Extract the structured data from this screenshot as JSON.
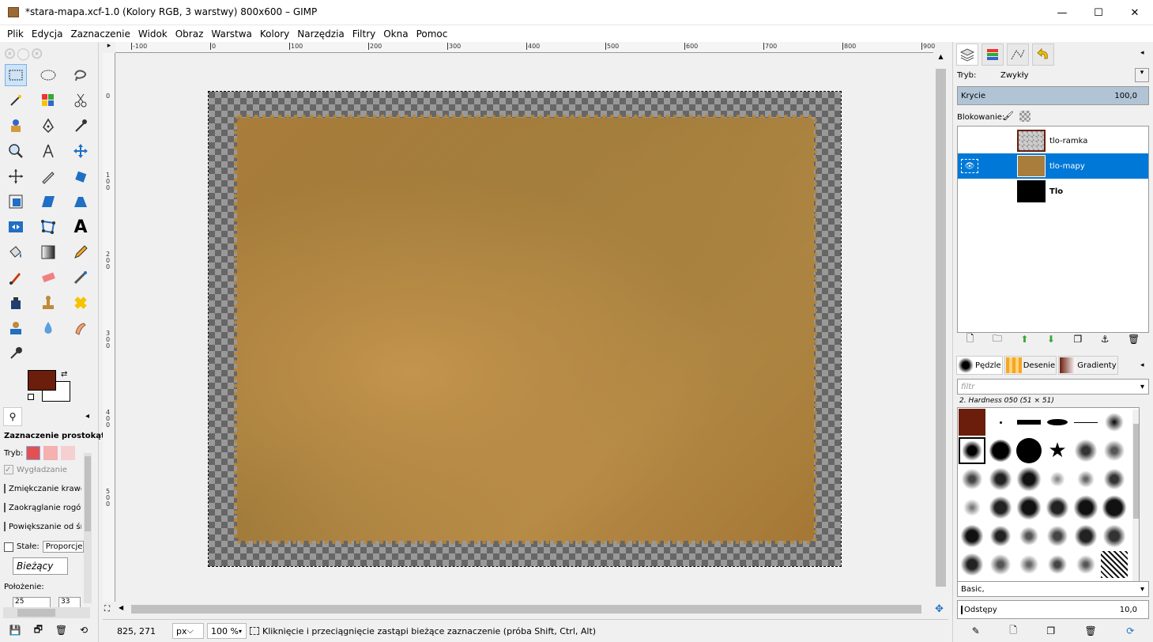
{
  "window": {
    "title": "*stara-mapa.xcf-1.0 (Kolory RGB, 3 warstwy) 800x600 – GIMP"
  },
  "menu": [
    "Plik",
    "Edycja",
    "Zaznaczenie",
    "Widok",
    "Obraz",
    "Warstwa",
    "Kolory",
    "Narzędzia",
    "Filtry",
    "Okna",
    "Pomoc"
  ],
  "ruler": {
    "h_labels": [
      "-100",
      "0",
      "100",
      "200",
      "300",
      "400",
      "500",
      "600",
      "700",
      "800",
      "900"
    ],
    "v_labels": [
      "0",
      "1\n0\n0",
      "2\n0\n0",
      "3\n0\n0",
      "4\n0\n0",
      "5\n0\n0"
    ]
  },
  "tool_options": {
    "title": "Zaznaczenie prostokątne",
    "mode_label": "Tryb:",
    "antialias": "Wygładzanie",
    "feather": "Zmiękczanie krawędzi",
    "rounded": "Zaokrąglanie rogów",
    "expand": "Powiększanie od środka",
    "fixed": "Stałe:",
    "fixed_value": "Proporcje",
    "current": "Bieżący",
    "position": "Położenie:",
    "pos_x": "25",
    "pos_y": "33"
  },
  "status": {
    "coords": "825, 271",
    "unit": "px",
    "zoom": "100 %",
    "message": "Kliknięcie i przeciągnięcie zastąpi bieżące zaznaczenie (próba Shift, Ctrl, Alt)"
  },
  "layers_panel": {
    "mode_label": "Tryb:",
    "mode_value": "Zwykły",
    "opacity_label": "Krycie",
    "opacity_value": "100,0",
    "lock_label": "Blokowanie:",
    "layers": [
      {
        "name": "tlo-ramka",
        "color": "#6b1e0c"
      },
      {
        "name": "tlo-mapy",
        "color": "#a97d3b"
      },
      {
        "name": "Tlo",
        "color": "#000000"
      }
    ]
  },
  "brushes_panel": {
    "tabs": [
      "Pędzle",
      "Desenie",
      "Gradienty"
    ],
    "filter_placeholder": "filtr",
    "selected_brush": "2. Hardness 050 (51 × 51)",
    "preset": "Basic,",
    "spacing_label": "Odstępy",
    "spacing_value": "10,0"
  }
}
